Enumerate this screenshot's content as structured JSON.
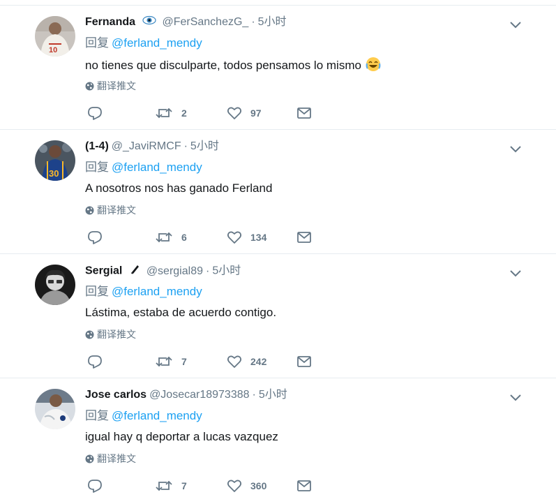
{
  "tweets": [
    {
      "name": "Fernanda",
      "badge_icon": "eye-icon",
      "handle": "@FerSanchezG_",
      "dot": "·",
      "time": "5小时",
      "reply_prefix": "回复",
      "reply_mention": "@ferland_mendy",
      "text": "no tienes que disculparte, todos pensamos lo mismo",
      "emoji": "face-with-tears-of-joy",
      "translate": "翻译推文",
      "retweets": "2",
      "likes": "97"
    },
    {
      "name": "(1-4)",
      "badge_icon": "",
      "handle": "@_JaviRMCF",
      "dot": "·",
      "time": "5小时",
      "reply_prefix": "回复",
      "reply_mention": "@ferland_mendy",
      "text": "A nosotros nos has ganado Ferland",
      "emoji": "",
      "translate": "翻译推文",
      "retweets": "6",
      "likes": "134"
    },
    {
      "name": "Sergial",
      "badge_icon": "pen-icon",
      "handle": "@sergial89",
      "dot": "·",
      "time": "5小时",
      "reply_prefix": "回复",
      "reply_mention": "@ferland_mendy",
      "text": "Lástima, estaba de acuerdo contigo.",
      "emoji": "",
      "translate": "翻译推文",
      "retweets": "7",
      "likes": "242"
    },
    {
      "name": "Jose carlos",
      "badge_icon": "",
      "handle": "@Josecar18973388",
      "dot": "·",
      "time": "5小时",
      "reply_prefix": "回复",
      "reply_mention": "@ferland_mendy",
      "text": "igual hay q deportar a lucas vazquez",
      "emoji": "",
      "translate": "翻译推文",
      "retweets": "7",
      "likes": "360"
    }
  ],
  "colors": {
    "link": "#1da1f2",
    "muted": "#657786",
    "text": "#14171a",
    "divider": "#e6ecf0"
  }
}
